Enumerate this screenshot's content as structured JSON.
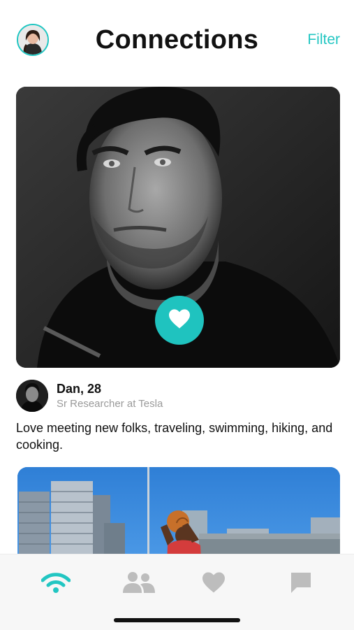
{
  "header": {
    "title": "Connections",
    "filter_label": "Filter"
  },
  "profile": {
    "name_age": "Dan, 28",
    "job": "Sr Researcher at Tesla",
    "bio": "Love meeting new folks, traveling, swimming, hiking, and cooking."
  },
  "icons": {
    "like": "heart-icon",
    "tab_discover": "signal-icon",
    "tab_people": "people-icon",
    "tab_likes": "heart-icon",
    "tab_chat": "chat-icon"
  },
  "colors": {
    "accent": "#22c6c2",
    "tab_inactive": "#bdbdbd",
    "secondary_text": "#9a9a9a"
  },
  "tabs": {
    "active_index": 0
  }
}
